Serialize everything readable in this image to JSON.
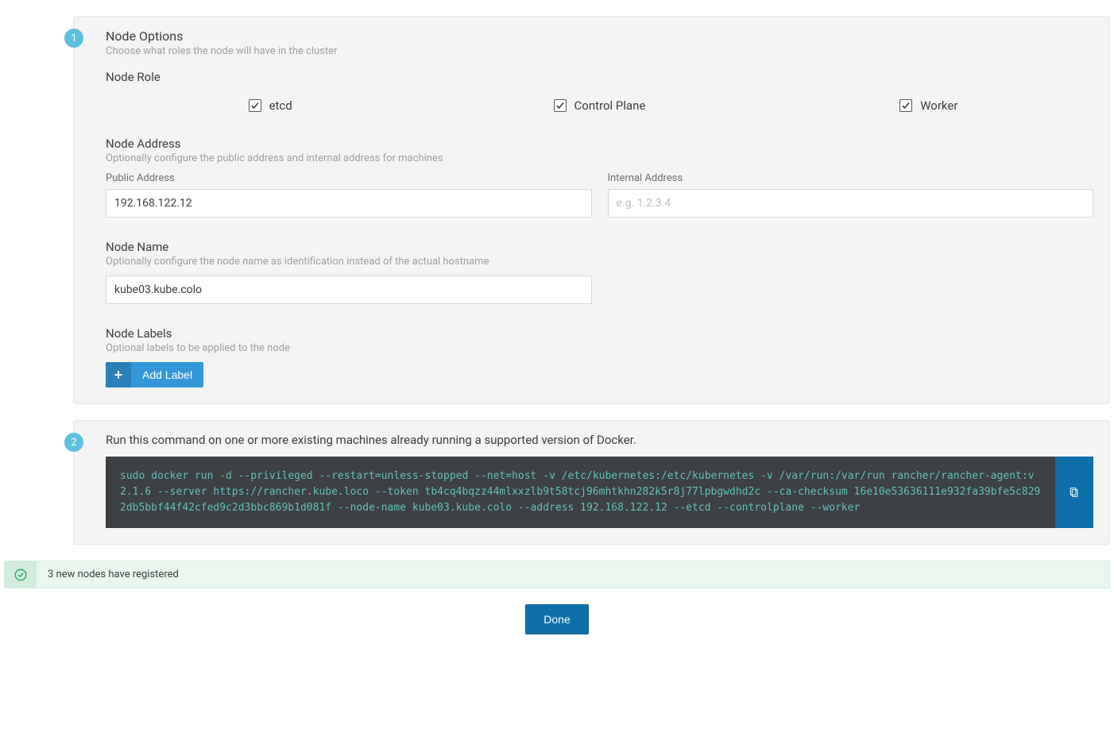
{
  "step1": {
    "badge": "1",
    "title": "Node Options",
    "subtitle": "Choose what roles the node will have in the cluster",
    "node_role": {
      "heading": "Node Role",
      "etcd": "etcd",
      "control_plane": "Control Plane",
      "worker": "Worker"
    },
    "node_address": {
      "heading": "Node Address",
      "subtitle": "Optionally configure the public address and internal address for machines",
      "public_label": "Public Address",
      "public_value": "192.168.122.12",
      "internal_label": "Internal Address",
      "internal_placeholder": "e.g. 1.2.3.4"
    },
    "node_name": {
      "heading": "Node Name",
      "subtitle": "Optionally configure the node name as identification instead of the actual hostname",
      "value": "kube03.kube.colo"
    },
    "node_labels": {
      "heading": "Node Labels",
      "subtitle": "Optional labels to be applied to the node",
      "add_button": "Add Label"
    }
  },
  "step2": {
    "badge": "2",
    "text": "Run this command on one or more existing machines already running a supported version of Docker.",
    "command": "sudo docker run -d --privileged --restart=unless-stopped --net=host -v /etc/kubernetes:/etc/kubernetes -v /var/run:/var/run rancher/rancher-agent:v2.1.6 --server https://rancher.kube.loco --token tb4cq4bqzz44mlxxzlb9t58tcj96mhtkhn282k5r8j77lpbgwdhd2c --ca-checksum 16e10e53636111e932fa39bfe5c8292db5bbf44f42cfed9c2d3bbc869b1d081f --node-name kube03.kube.colo --address 192.168.122.12 --etcd --controlplane --worker"
  },
  "banner": {
    "text": "3 new nodes have registered"
  },
  "done_button": "Done"
}
